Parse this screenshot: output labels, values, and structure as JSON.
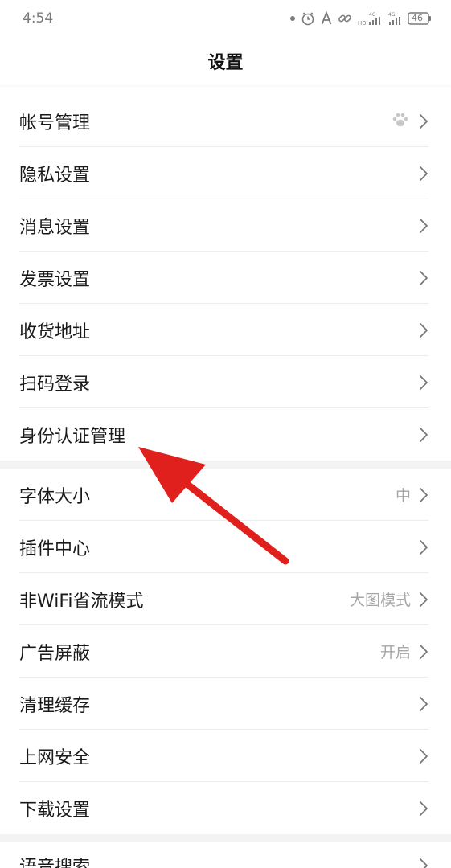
{
  "status_bar": {
    "time": "4:54",
    "battery": "46"
  },
  "header": {
    "title": "设置"
  },
  "groups": [
    {
      "items": [
        {
          "label": "帐号管理",
          "value": "",
          "icon": "paw-icon"
        },
        {
          "label": "隐私设置",
          "value": ""
        },
        {
          "label": "消息设置",
          "value": ""
        },
        {
          "label": "发票设置",
          "value": ""
        },
        {
          "label": "收货地址",
          "value": ""
        },
        {
          "label": "扫码登录",
          "value": ""
        },
        {
          "label": "身份认证管理",
          "value": ""
        }
      ]
    },
    {
      "items": [
        {
          "label": "字体大小",
          "value": "中"
        },
        {
          "label": "插件中心",
          "value": ""
        },
        {
          "label": "非WiFi省流模式",
          "value": "大图模式"
        },
        {
          "label": "广告屏蔽",
          "value": "开启"
        },
        {
          "label": "清理缓存",
          "value": ""
        },
        {
          "label": "上网安全",
          "value": ""
        },
        {
          "label": "下载设置",
          "value": ""
        }
      ]
    },
    {
      "items": [
        {
          "label": "语音搜索",
          "value": ""
        }
      ]
    }
  ],
  "colors": {
    "annotation_arrow": "#e0201c"
  }
}
